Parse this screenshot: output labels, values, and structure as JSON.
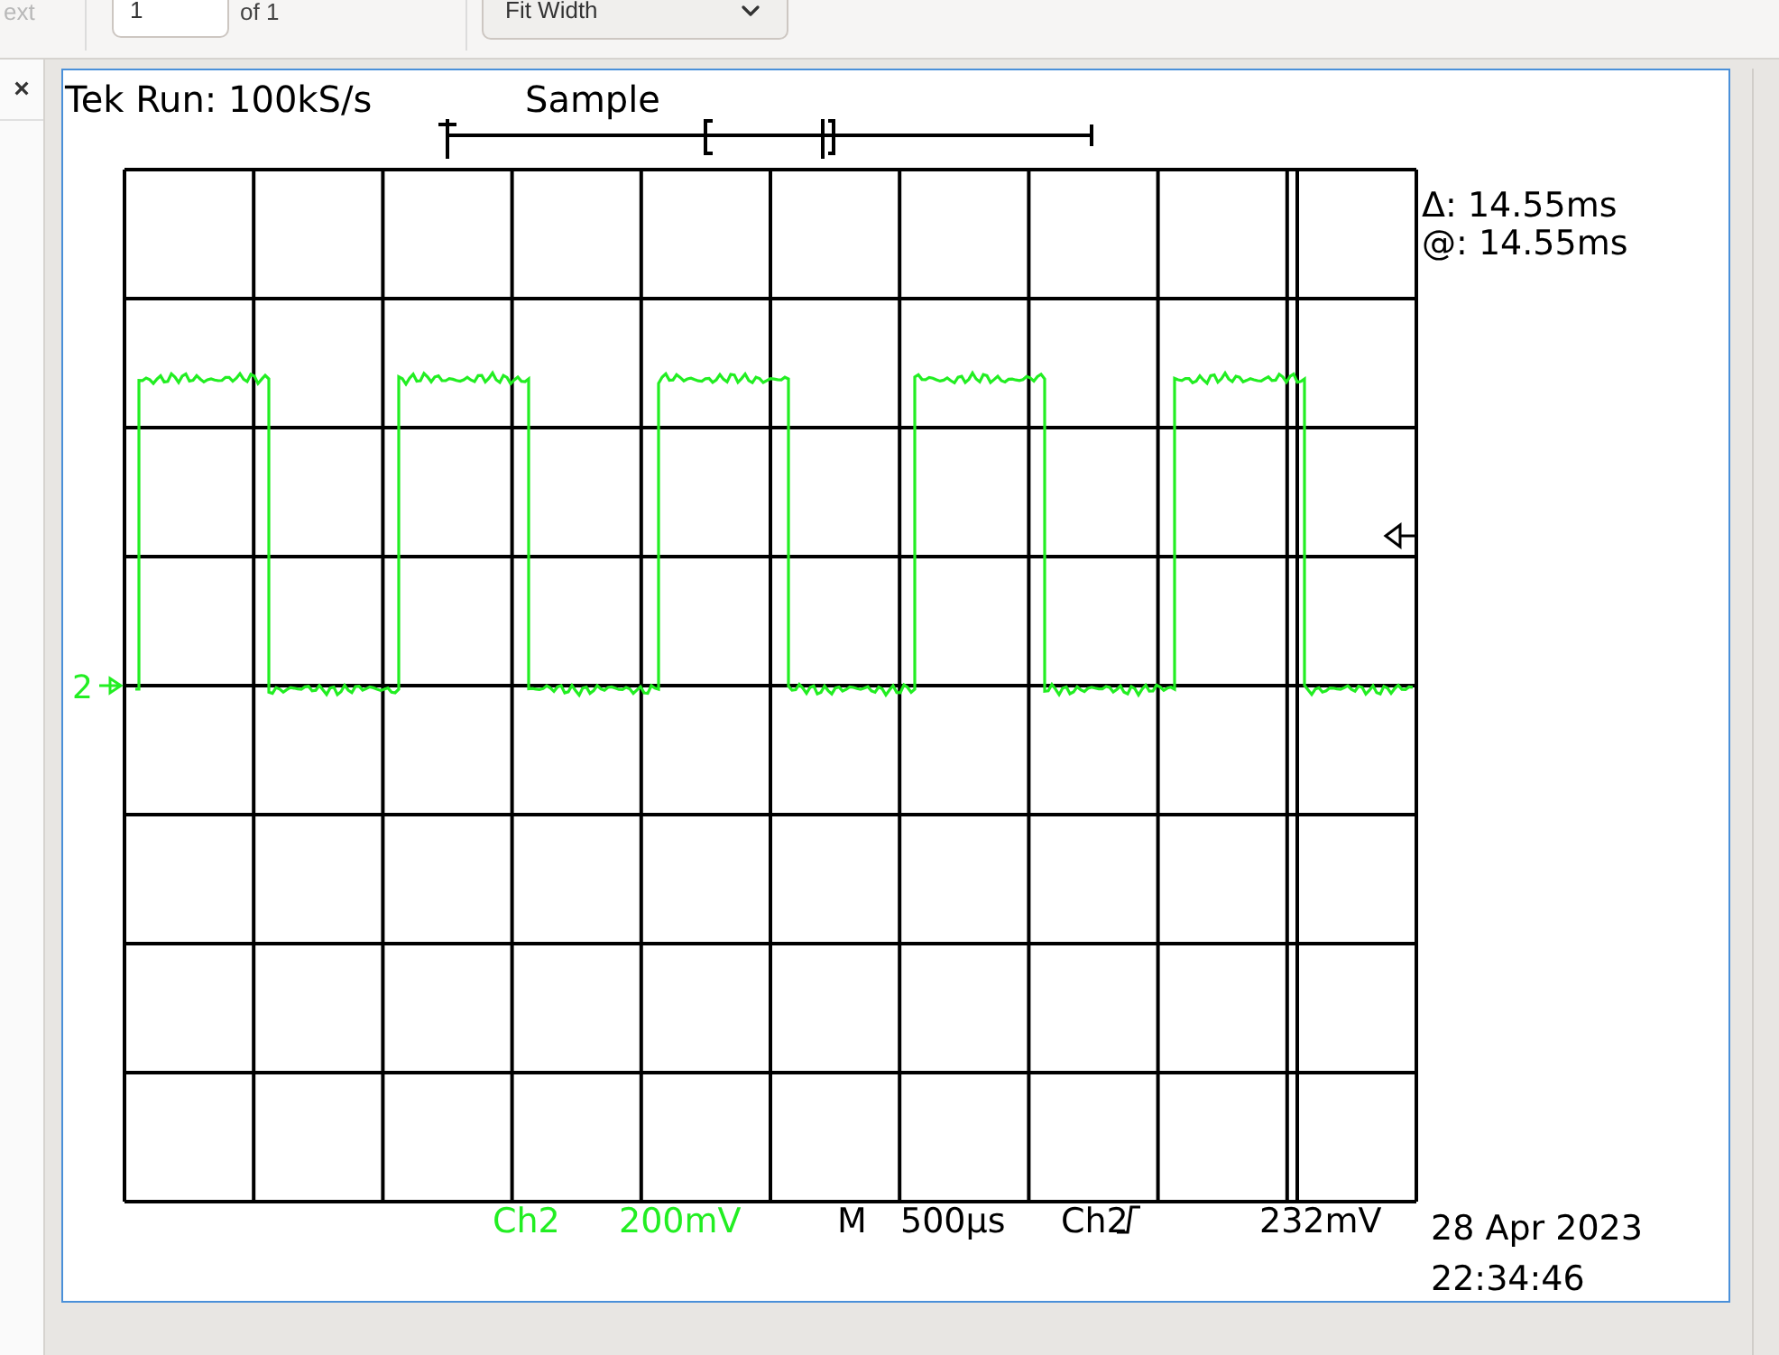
{
  "toolbar": {
    "next_label": "ext",
    "page_input": "1",
    "page_count": "of 1",
    "zoom_select": "Fit Width"
  },
  "sidebar": {
    "close": "×"
  },
  "scope": {
    "header": "Tek Run: 100kS/s",
    "mode": "Sample",
    "delta": "Δ: 14.55ms",
    "at": "@: 14.55ms",
    "channel_marker": "2",
    "ch_label": "Ch2",
    "ch_scale": "200mV",
    "timebase_label": "M",
    "timebase": "500µs",
    "trigger_source": "Ch2",
    "trigger_level": "232mV",
    "date": "28 Apr 2023",
    "time": "22:34:46"
  }
}
